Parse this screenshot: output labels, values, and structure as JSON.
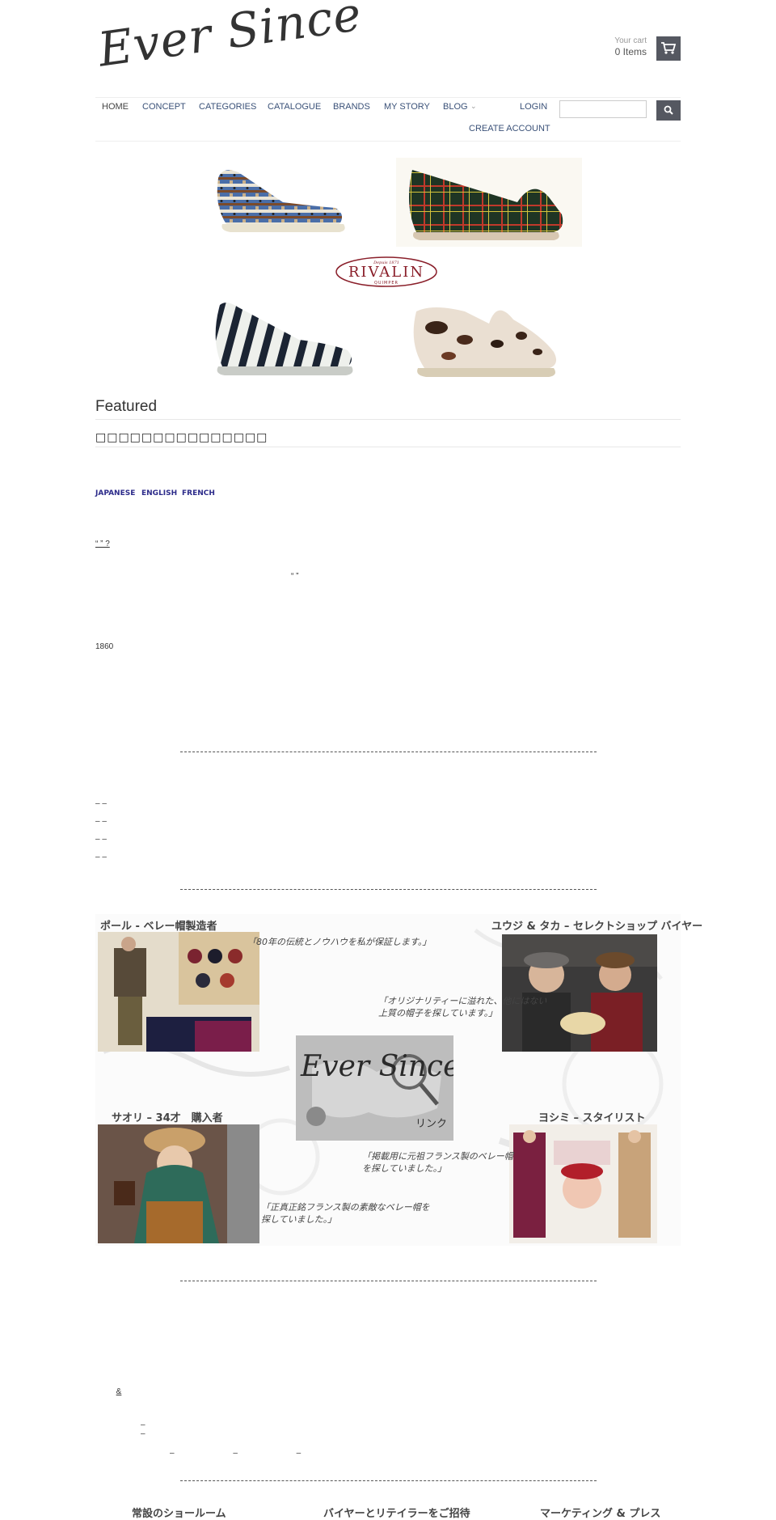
{
  "header": {
    "logo_text": "Ever Since",
    "cart_label": "Your cart",
    "cart_count": "0 Items"
  },
  "nav": {
    "items": [
      "HOME",
      "CONCEPT",
      "CATEGORIES",
      "CATALOGUE",
      "BRANDS",
      "MY STORY",
      "BLOG"
    ],
    "login": "LOGIN",
    "create_account": "CREATE ACCOUNT",
    "search_placeholder": ""
  },
  "banner": {
    "brand_logo_text": "RIVALIN",
    "brand_logo_sub": "QUIMPER",
    "brand_logo_top": "Depuis 1871"
  },
  "featured": {
    "title": "Featured",
    "subtitle": "□□□□□□□□□□□□□□□"
  },
  "languages": [
    "JAPANESE",
    "ENGLISH",
    "FRENCH"
  ],
  "content": {
    "question": "“ ” ?",
    "quote_marks": "“ ”",
    "year": "1860",
    "bullets": [
      "– –",
      "– –",
      "– –",
      "– –"
    ],
    "amp_line": "&",
    "dash_line_1": "– –",
    "dash_line_2": "– – –"
  },
  "collage": {
    "paul_label": "ポール - ベレー帽製造者",
    "paul_quote": "「80年の伝統とノウハウを私が保証します。」",
    "yuji_label": "ユウジ & タカ – セレクトショップ バイヤー",
    "yuji_quote_1": "「オリジナリティーに溢れた、他にはない",
    "yuji_quote_2": "上質の帽子を探しています。」",
    "center_logo": "Ever Since",
    "center_link": "リンク",
    "saori_label": "サオリ – 34才　購入者",
    "saori_quote_1": "「正真正銘フランス製の素敵なベレー帽を",
    "saori_quote_2": "探していました。」",
    "yoshimi_label": "ヨシミ – スタイリスト",
    "yoshimi_quote_1": "「掲載用に元祖フランス製のベレー帽",
    "yoshimi_quote_2": "を探していました。」"
  },
  "bottom_links": [
    "常設のショールーム",
    "バイヤーとリテイラーをご招待",
    "マーケティング & プレス"
  ]
}
